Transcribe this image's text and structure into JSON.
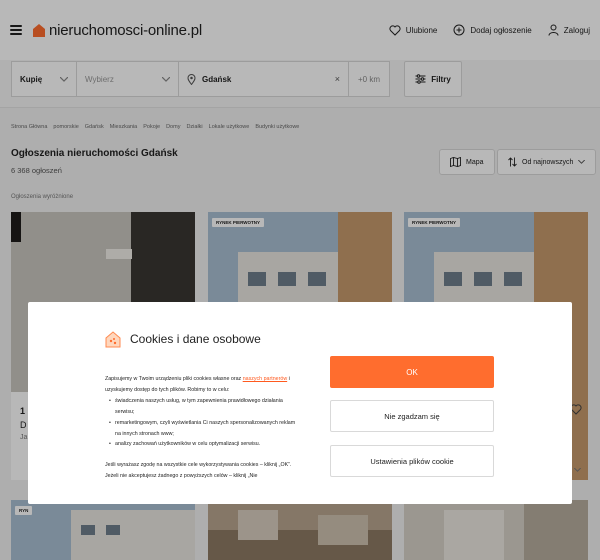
{
  "header": {
    "logo": "nieruchomosci-online.pl",
    "nav": [
      {
        "label": "Ulubione",
        "icon": "heart-icon"
      },
      {
        "label": "Dodaj ogłoszenie",
        "icon": "plus-circle-icon"
      },
      {
        "label": "Zaloguj",
        "icon": "user-icon"
      }
    ]
  },
  "search": {
    "transaction": "Kupię",
    "category_placeholder": "Wybierz",
    "location": "Gdańsk",
    "radius": "+0 km",
    "filters_label": "Filtry"
  },
  "breadcrumbs": [
    "Strona Główna",
    "pomorskie",
    "Gdańsk",
    "Mieszkania",
    "Pokoje",
    "Domy",
    "Działki",
    "Lokale użytkowe",
    "Budynki użytkowe"
  ],
  "listing": {
    "title": "Ogłoszenia nieruchomości Gdańsk",
    "count": "6 368 ogłoszeń",
    "map_label": "Mapa",
    "sort_label": "Od najnowszych",
    "featured_label": "Ogłoszenia wyróżnione"
  },
  "cards": [
    {
      "badge": ""
    },
    {
      "badge": "RYNEK PIERWOTNY"
    },
    {
      "badge": "RYNEK PIERWOTNY"
    },
    {
      "badge": "RYN"
    },
    {
      "badge": ""
    },
    {
      "badge": ""
    }
  ],
  "card_partial": {
    "price_fragment": "1",
    "line2_fragment": "D",
    "line3_fragment": "Ja"
  },
  "cookies": {
    "title": "Cookies i dane osobowe",
    "intro_1": "Zapisujemy w Twoim urządzeniu pliki cookies własne oraz ",
    "intro_link": "naszych partnerów",
    "intro_2": " i uzyskujemy dostęp do tych plików. Robimy to w celu:",
    "bullets": [
      "świadczenia naszych usług, w tym zapewnienia prawidłowego działania serwisu;",
      "remarketingowym, czyli wyświetlania Ci naszych spersonalizowanych reklam na innych stronach www;",
      "analizy zachowań użytkowników w celu optymalizacji serwisu."
    ],
    "p2": "Jeśli wyrażasz zgodę na wszystkie cele wykorzystywania cookies – kliknij „OK”.",
    "p3": "Jeżeli nie akceptujesz żadnego z powyższych celów – kliknij „Nie",
    "ok": "OK",
    "reject": "Nie zgadzam się",
    "settings": "Ustawienia plików cookie"
  },
  "colors": {
    "accent": "#ff6d2e",
    "link": "#ff5a1f"
  }
}
